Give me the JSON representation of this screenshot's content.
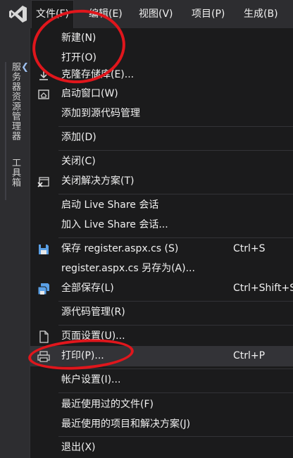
{
  "menubar": {
    "items": [
      "文件(F)",
      "编辑(E)",
      "视图(V)",
      "项目(P)",
      "生成(B)"
    ]
  },
  "toolstrip": {
    "tabs": [
      "服务器资源管理器",
      "工具箱"
    ]
  },
  "file_menu": {
    "items": [
      {
        "label": "新建(N)",
        "shortcut": "",
        "icon": ""
      },
      {
        "label": "打开(O)",
        "shortcut": "",
        "icon": ""
      },
      {
        "label": "克隆存储库(E)...",
        "shortcut": "",
        "icon": "download-icon"
      },
      {
        "label": "启动窗口(W)",
        "shortcut": "",
        "icon": "home-window-icon"
      },
      {
        "label": "添加到源代码管理",
        "shortcut": "",
        "icon": ""
      },
      {
        "label": "添加(D)",
        "shortcut": "",
        "icon": ""
      },
      {
        "label": "关闭(C)",
        "shortcut": "",
        "icon": ""
      },
      {
        "label": "关闭解决方案(T)",
        "shortcut": "",
        "icon": "close-solution-icon"
      },
      {
        "label": "启动 Live Share 会话",
        "shortcut": "",
        "icon": ""
      },
      {
        "label": "加入 Live Share 会话...",
        "shortcut": "",
        "icon": ""
      },
      {
        "label": "保存 register.aspx.cs (S)",
        "shortcut": "Ctrl+S",
        "icon": "save-icon"
      },
      {
        "label": "register.aspx.cs 另存为(A)...",
        "shortcut": "",
        "icon": ""
      },
      {
        "label": "全部保存(L)",
        "shortcut": "Ctrl+Shift+S",
        "icon": "save-all-icon"
      },
      {
        "label": "源代码管理(R)",
        "shortcut": "",
        "icon": ""
      },
      {
        "label": "页面设置(U)...",
        "shortcut": "",
        "icon": "page-setup-icon"
      },
      {
        "label": "打印(P)...",
        "shortcut": "Ctrl+P",
        "icon": "print-icon"
      },
      {
        "label": "帐户设置(I)...",
        "shortcut": "",
        "icon": ""
      },
      {
        "label": "最近使用过的文件(F)",
        "shortcut": "",
        "icon": ""
      },
      {
        "label": "最近使用的项目和解决方案(J)",
        "shortcut": "",
        "icon": ""
      },
      {
        "label": "退出(X)",
        "shortcut": "",
        "icon": ""
      }
    ]
  },
  "colors": {
    "accent": "#68217a",
    "annotation": "#e0161c",
    "menu_bg": "#1b1b1c",
    "hover_bg": "#333337"
  }
}
